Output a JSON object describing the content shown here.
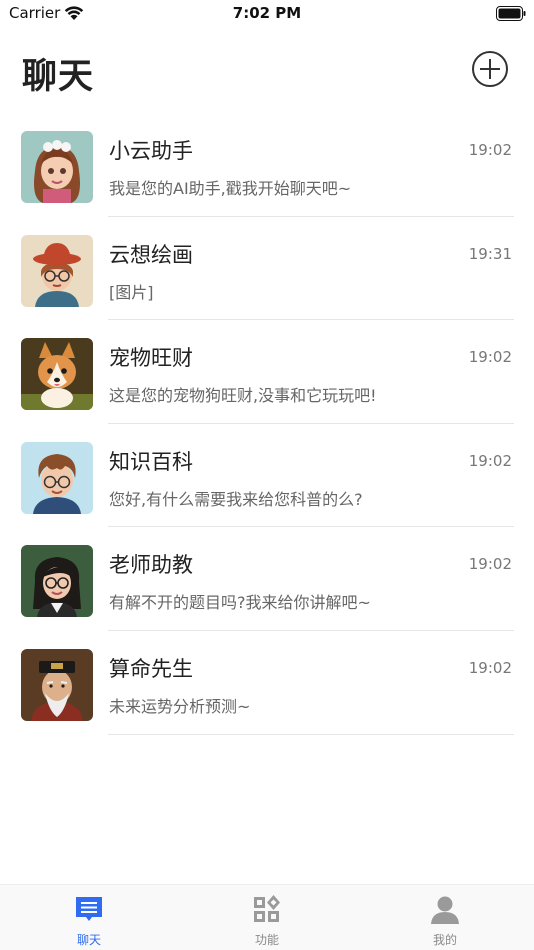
{
  "status_bar": {
    "carrier": "Carrier",
    "time": "7:02 PM"
  },
  "header": {
    "title": "聊天",
    "add_icon": "plus-circle-icon"
  },
  "chats": [
    {
      "name": "小云助手",
      "time": "19:02",
      "preview": "我是您的AI助手,戳我开始聊天吧~",
      "avatar": "girl-avatar"
    },
    {
      "name": "云想绘画",
      "time": "19:31",
      "preview": "[图片]",
      "avatar": "painter-avatar"
    },
    {
      "name": "宠物旺财",
      "time": "19:02",
      "preview": "这是您的宠物狗旺财,没事和它玩玩吧!",
      "avatar": "corgi-avatar"
    },
    {
      "name": "知识百科",
      "time": "19:02",
      "preview": "您好,有什么需要我来给您科普的么?",
      "avatar": "boy-avatar"
    },
    {
      "name": "老师助教",
      "time": "19:02",
      "preview": "有解不开的题目吗?我来给你讲解吧~",
      "avatar": "teacher-avatar"
    },
    {
      "name": "算命先生",
      "time": "19:02",
      "preview": "未来运势分析预测~",
      "avatar": "fortune-teller-avatar"
    }
  ],
  "tab_bar": {
    "items": [
      {
        "label": "聊天",
        "icon": "chat-icon",
        "active": true
      },
      {
        "label": "功能",
        "icon": "apps-icon",
        "active": false
      },
      {
        "label": "我的",
        "icon": "profile-icon",
        "active": false
      }
    ]
  },
  "colors": {
    "accent": "#2f6cf0",
    "inactive": "#8a8a8a",
    "text": "#222222",
    "secondary_text": "#666666"
  }
}
